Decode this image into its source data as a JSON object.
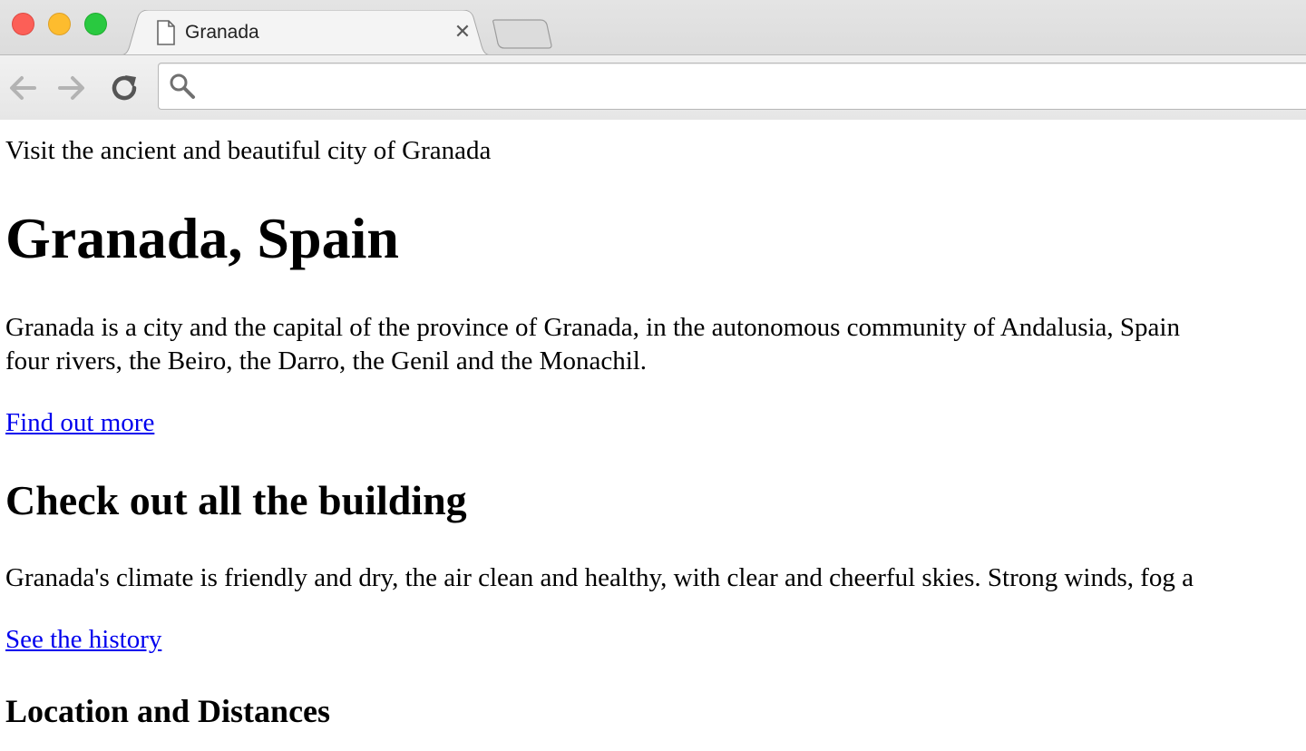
{
  "browser": {
    "tab": {
      "title": "Granada"
    },
    "omnibox": {
      "value": "",
      "placeholder": ""
    },
    "colors": {
      "close": "#fc5f57",
      "minimize": "#fdbc2e",
      "maximize": "#29c940"
    }
  },
  "page": {
    "tagline": "Visit the ancient and beautiful city of Granada",
    "heading": "Granada, Spain",
    "intro_line1": "Granada is a city and the capital of the province of Granada, in the autonomous community of Andalusia, Spain",
    "intro_line2": "four rivers, the Beiro, the Darro, the Genil and the Monachil.",
    "link_more": "Find out more",
    "section_heading": "Check out all the building",
    "climate_text": "Granada's climate is friendly and dry, the air clean and healthy, with clear and cheerful skies. Strong winds, fog a",
    "link_history": "See the history",
    "subheading": "Location and Distances",
    "link_color": "#0000ee"
  }
}
